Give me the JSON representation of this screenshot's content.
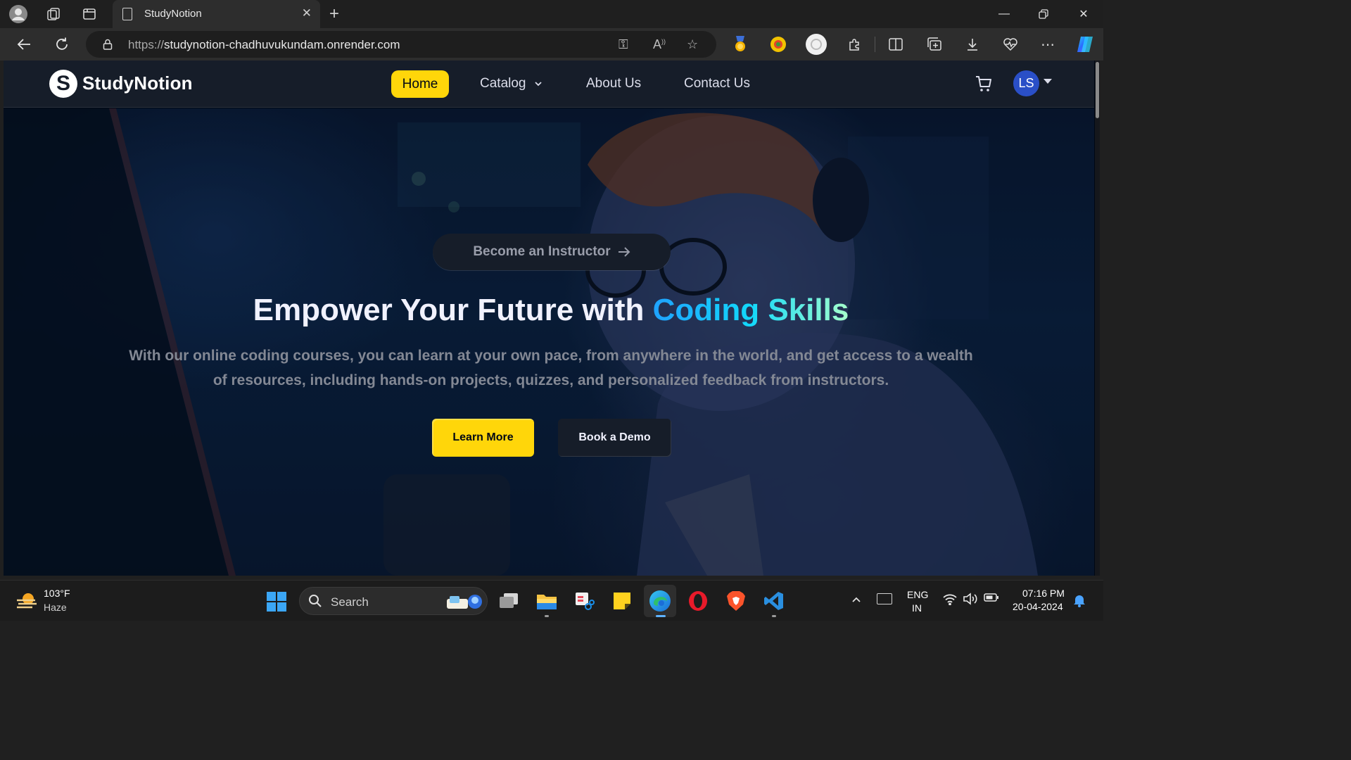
{
  "browser": {
    "tab_title": "StudyNotion",
    "url_protocol": "https://",
    "url_host": "studynotion-chadhuvukundam.onrender.com",
    "icons": [
      "profile-icon",
      "workspaces-icon",
      "tab-actions-icon",
      "back-icon",
      "refresh-icon",
      "lock-icon",
      "key-icon",
      "read-aloud-icon",
      "favorite-star-icon",
      "extension-medal-icon",
      "extension-color-icon",
      "extension-white-icon",
      "extensions-puzzle-icon",
      "split-screen-icon",
      "collections-icon",
      "downloads-icon",
      "browser-essentials-icon",
      "more-icon",
      "copilot-icon",
      "minimize-icon",
      "restore-icon",
      "close-icon"
    ]
  },
  "site": {
    "logo_letter": "S",
    "logo_text": "StudyNotion",
    "nav": {
      "home": "Home",
      "catalog": "Catalog",
      "about": "About Us",
      "contact": "Contact Us"
    },
    "avatar_initials": "LS",
    "accent_yellow": "#FFD60A",
    "nav_bg": "#161D29"
  },
  "hero": {
    "instructor_cta": "Become an Instructor",
    "heading_plain": "Empower Your Future with ",
    "heading_highlight": "Coding Skills",
    "subtext_line1": "With our online coding courses, you can learn at your own pace, from anywhere in the world, and get access to a wealth",
    "subtext_line2": "of resources, including hands-on projects, quizzes, and personalized feedback from instructors.",
    "learn_more": "Learn More",
    "book_demo": "Book a Demo"
  },
  "taskbar": {
    "weather_temp": "103°F",
    "weather_desc": "Haze",
    "search_label": "Search",
    "lang_line1": "ENG",
    "lang_line2": "IN",
    "time": "07:16 PM",
    "date": "20-04-2024",
    "apps": [
      "windows-start-icon",
      "task-view-icon",
      "file-explorer-icon",
      "snipping-tool-icon",
      "sticky-notes-icon",
      "edge-icon",
      "opera-icon",
      "brave-icon",
      "vscode-icon"
    ]
  }
}
